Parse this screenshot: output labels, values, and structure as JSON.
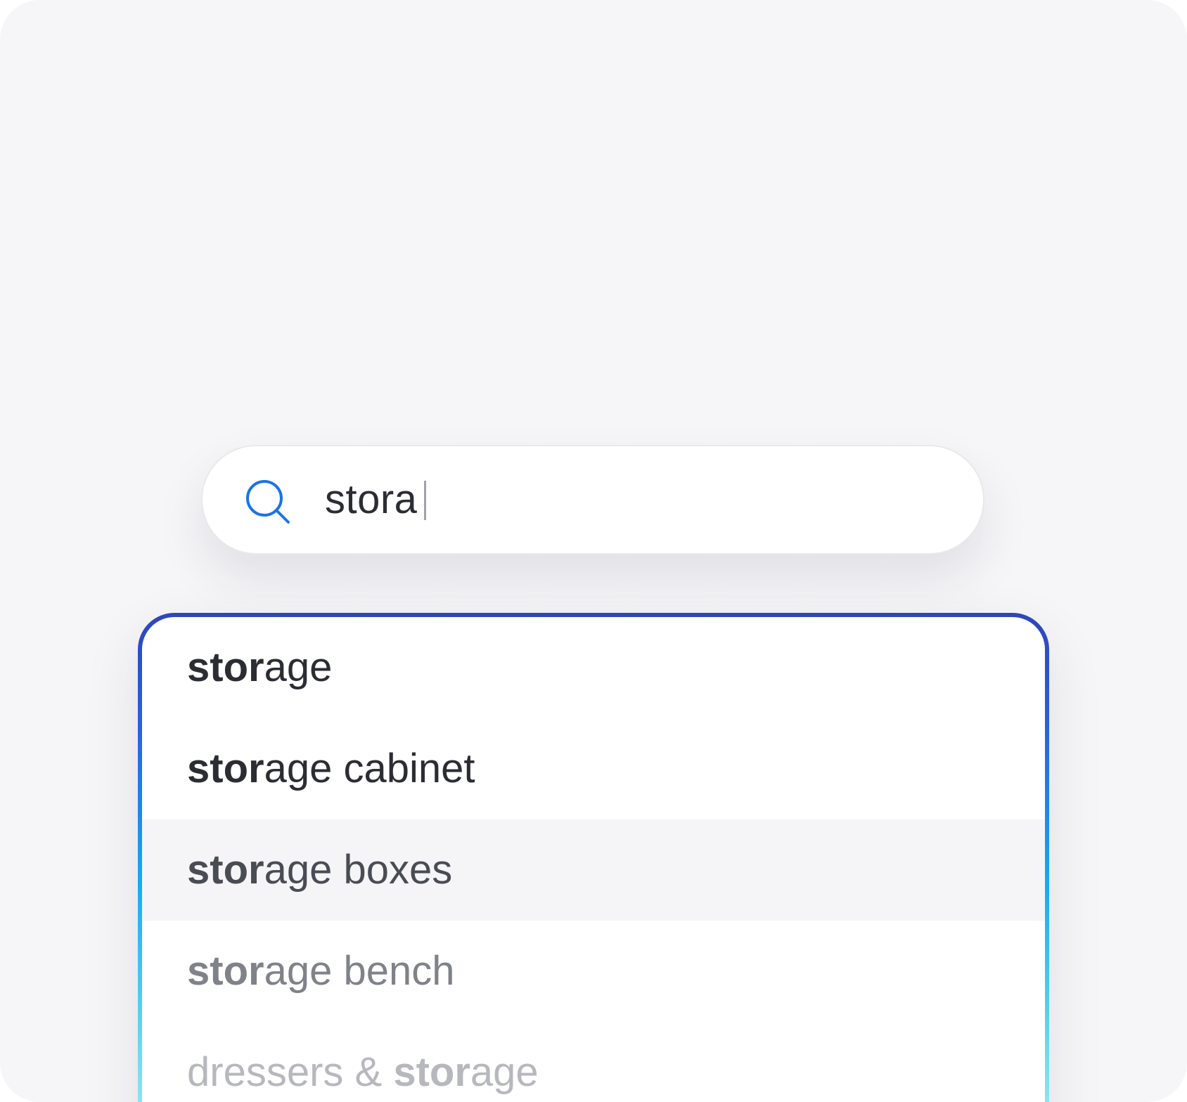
{
  "search": {
    "value": "stora",
    "icon": "search-icon",
    "accent_color": "#1a73e8"
  },
  "suggestions": [
    {
      "match": "stor",
      "rest": "age",
      "prefix": "",
      "state": "normal"
    },
    {
      "match": "stor",
      "rest": "age cabinet",
      "prefix": "",
      "state": "normal"
    },
    {
      "match": "stor",
      "rest": "age boxes",
      "prefix": "",
      "state": "highlighted"
    },
    {
      "match": "stor",
      "rest": "age bench",
      "prefix": "",
      "state": "faded"
    },
    {
      "match": "stor",
      "rest": "age",
      "prefix": "dressers & ",
      "state": "faded"
    }
  ],
  "colors": {
    "background": "#f6f6f8",
    "dropdown_border_gradient": [
      "#2f46b8",
      "#2a62dc",
      "#15a9f2",
      "#5fd6ee",
      "#a7ecf2"
    ],
    "text_primary": "#2b2d33",
    "highlight_row": "#f5f5f7"
  }
}
